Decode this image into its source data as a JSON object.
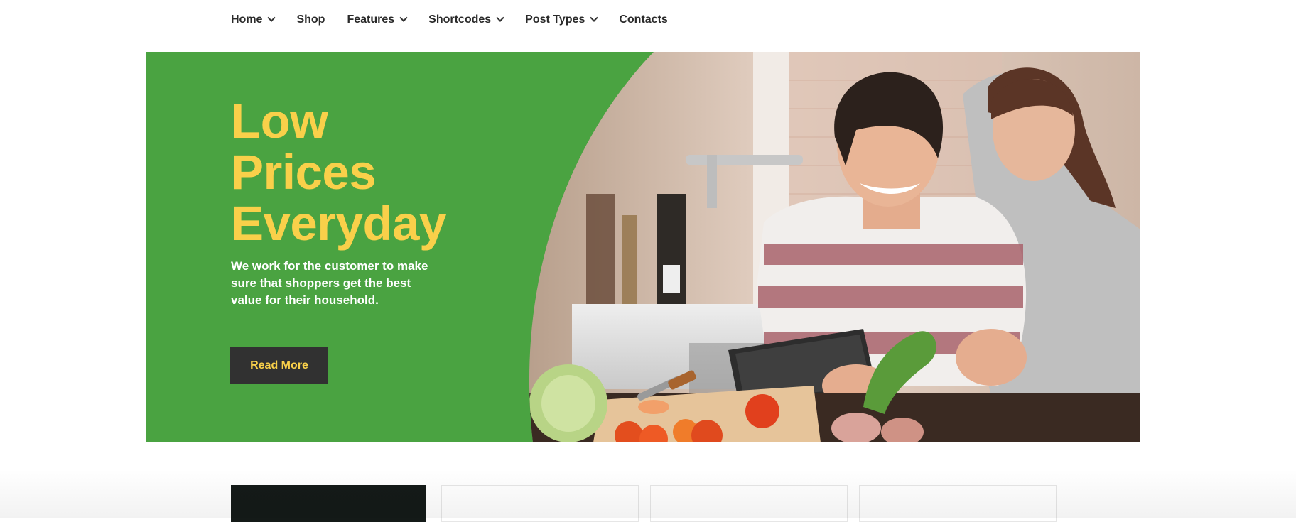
{
  "nav": {
    "items": [
      {
        "label": "Home",
        "has_dropdown": true
      },
      {
        "label": "Shop",
        "has_dropdown": false
      },
      {
        "label": "Features",
        "has_dropdown": true
      },
      {
        "label": "Shortcodes",
        "has_dropdown": true
      },
      {
        "label": "Post Types",
        "has_dropdown": true
      },
      {
        "label": "Contacts",
        "has_dropdown": false
      }
    ]
  },
  "hero": {
    "title_lines": [
      "Low",
      "Prices",
      "Everyday"
    ],
    "text": "We work for the customer to make sure that shoppers get the best value for their household.",
    "button_label": "Read More"
  },
  "colors": {
    "brand_green": "#4aa341",
    "accent_yellow": "#f9d04a",
    "button_dark": "#313131",
    "nav_text": "#2a2a2a"
  }
}
